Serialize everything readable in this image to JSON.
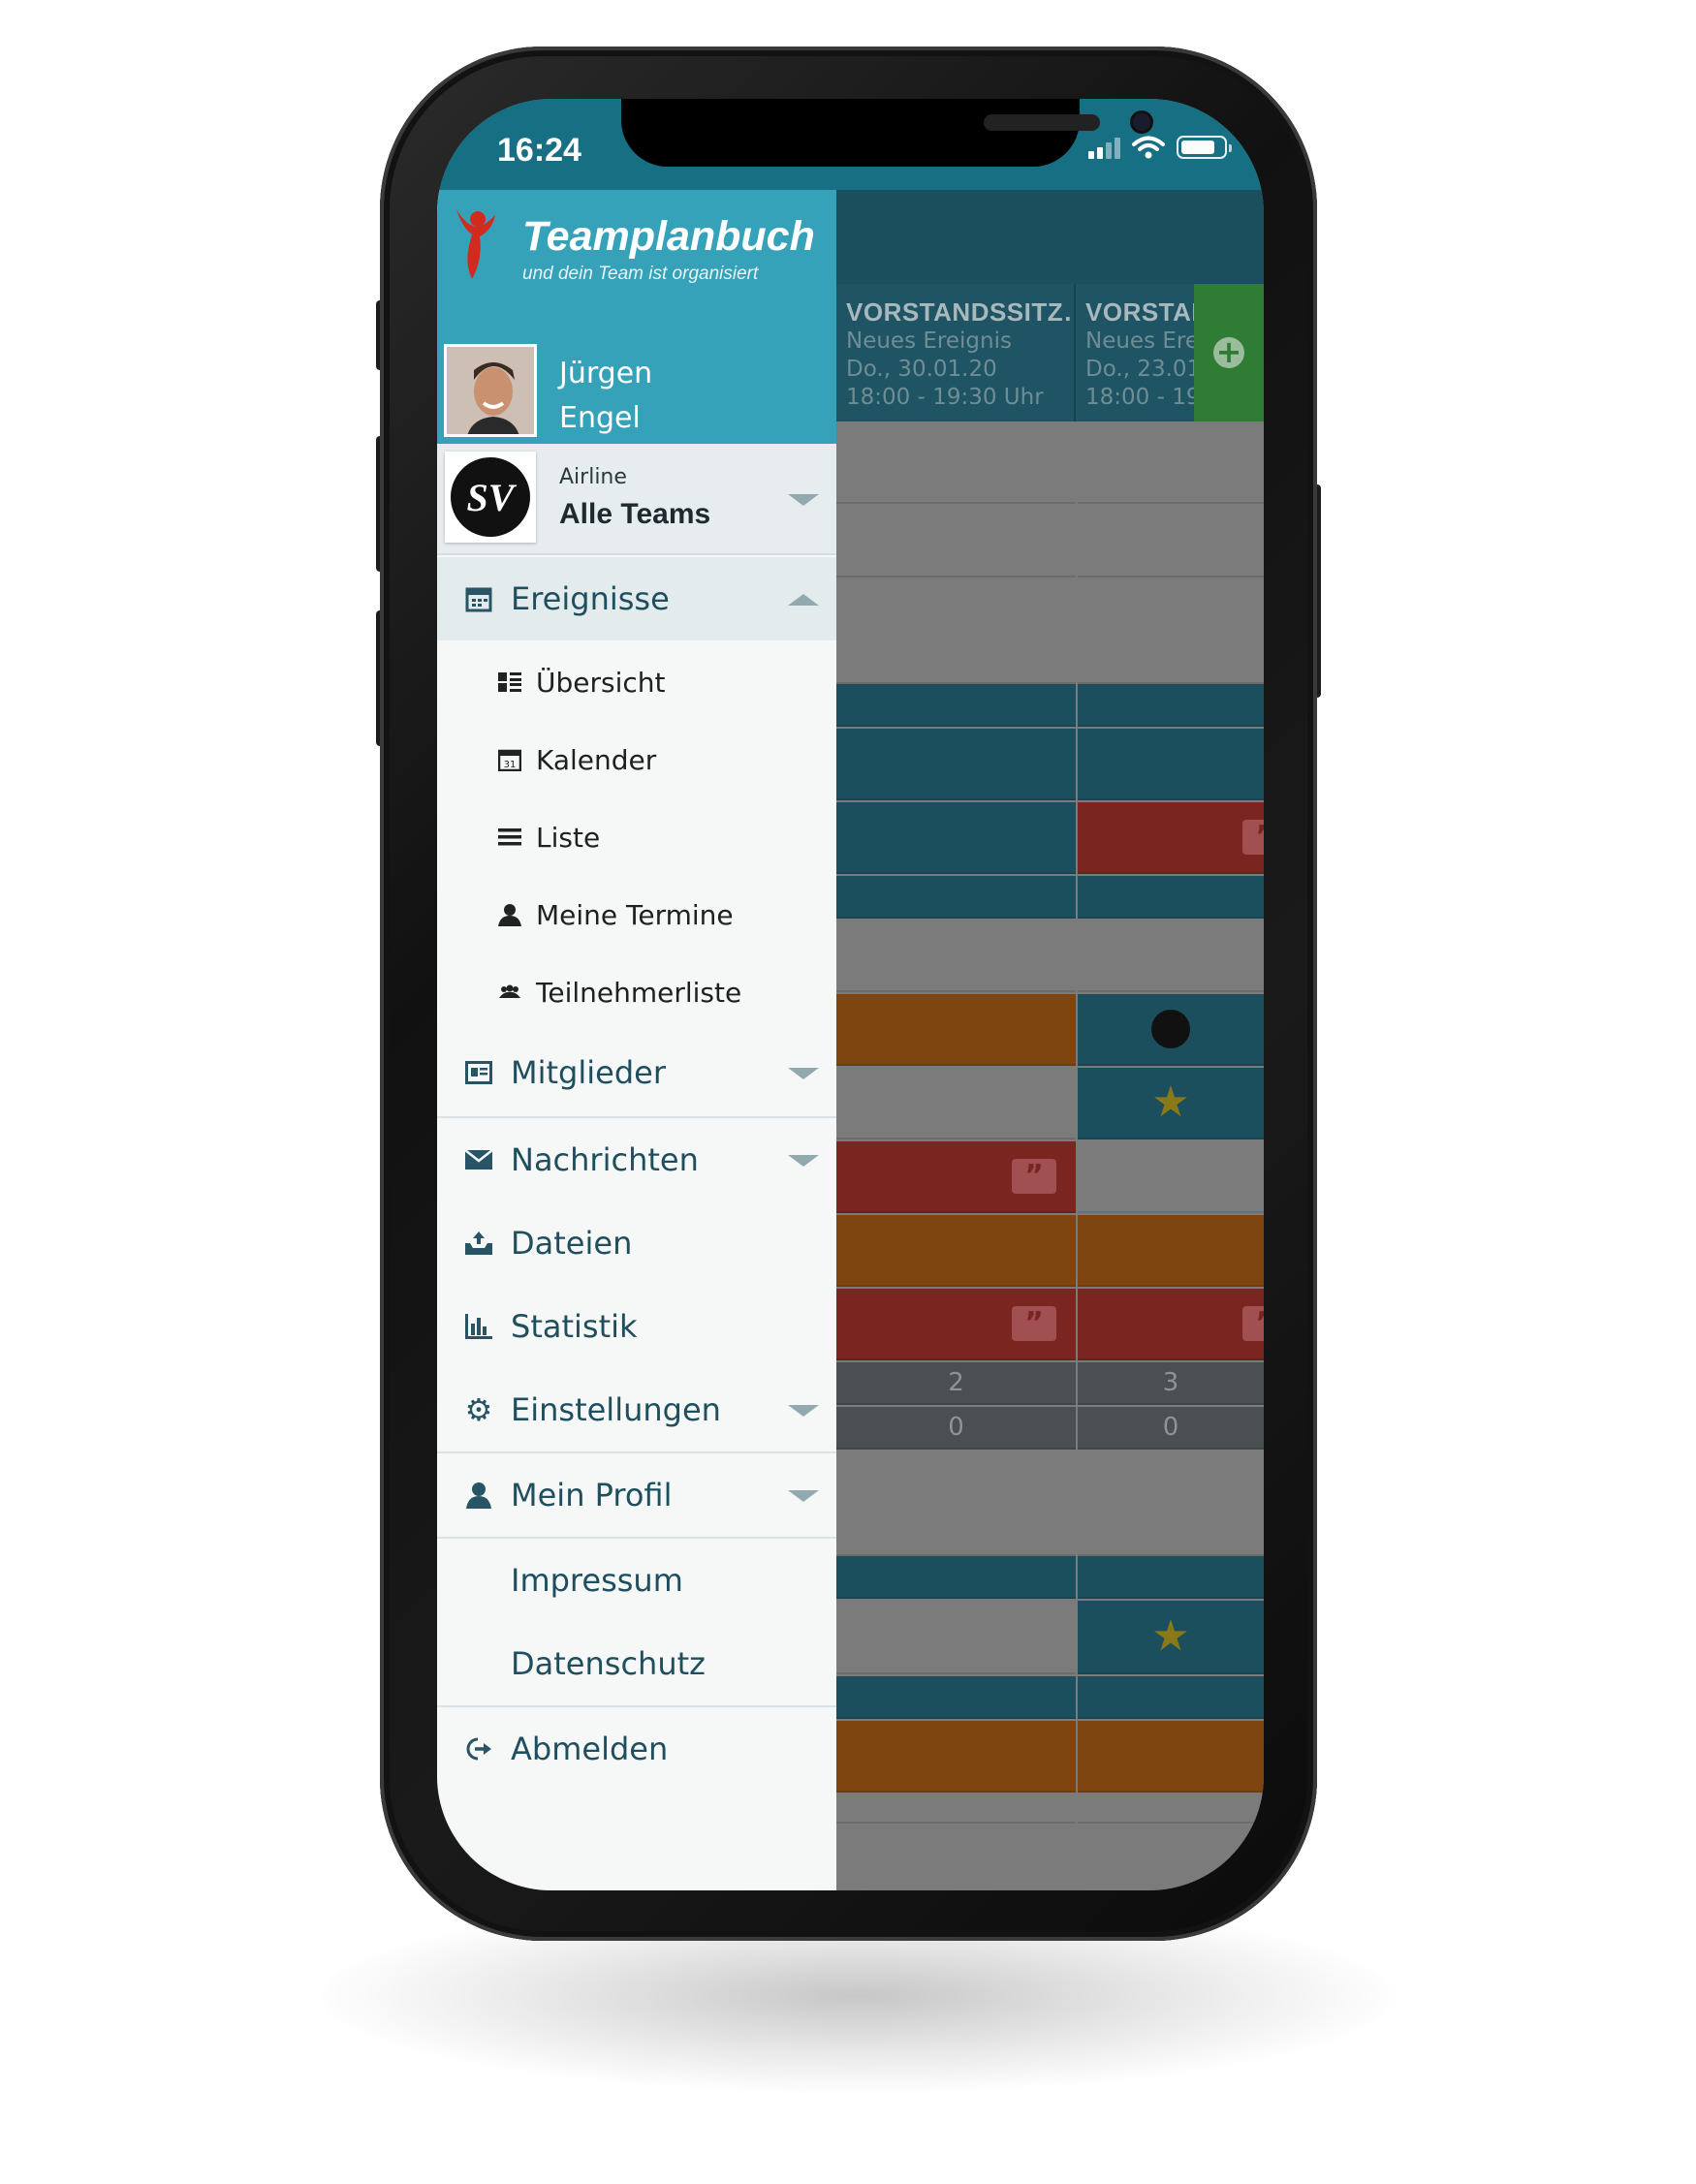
{
  "status_bar": {
    "time": "16:24"
  },
  "app": {
    "title": "Teamplanbuch",
    "subtitle": "und dein Team ist organisiert"
  },
  "user": {
    "first_name": "Jürgen",
    "last_name": "Engel"
  },
  "team": {
    "organization": "Airline",
    "name": "Alle Teams",
    "logo_text": "SV"
  },
  "menu": {
    "events": {
      "label": "Ereignisse",
      "icon": "calendar-icon",
      "expanded": true
    },
    "events_sub": [
      {
        "label": "Übersicht",
        "icon": "overview-icon"
      },
      {
        "label": "Kalender",
        "icon": "calendar-31-icon"
      },
      {
        "label": "Liste",
        "icon": "list-icon"
      },
      {
        "label": "Meine Termine",
        "icon": "user-icon"
      },
      {
        "label": "Teilnehmerliste",
        "icon": "group-icon"
      }
    ],
    "members": {
      "label": "Mitglieder",
      "icon": "id-card-icon"
    },
    "messages": {
      "label": "Nachrichten",
      "icon": "envelope-icon"
    },
    "files": {
      "label": "Dateien",
      "icon": "inbox-upload-icon"
    },
    "statistics": {
      "label": "Statistik",
      "icon": "bar-chart-icon"
    },
    "settings": {
      "label": "Einstellungen",
      "icon": "gear-icon"
    },
    "profile": {
      "label": "Mein Profil",
      "icon": "user-icon"
    },
    "imprint": {
      "label": "Impressum"
    },
    "privacy": {
      "label": "Datenschutz"
    },
    "logout": {
      "label": "Abmelden",
      "icon": "logout-icon"
    }
  },
  "calendar": {
    "columns": [
      {
        "title": "VORSTANDSSITZ…",
        "type": "Neues Ereignis",
        "date": "Do., 30.01.20",
        "time": "18:00 - 19:30 Uhr",
        "yes_count": "2",
        "no_count": "0"
      },
      {
        "title": "VORSTAND",
        "type": "Neues Ere",
        "date": "Do., 23.01",
        "time": "18:00 - 19",
        "yes_count": "3",
        "no_count": "0"
      }
    ]
  },
  "colors": {
    "brand": "#36a2ba",
    "status_bar": "#176f84",
    "teal_cell": "#1c4f5d",
    "red_cell": "#7a2520",
    "orange_cell": "#7f4510",
    "gray_cell": "#7b7b7b",
    "add_button": "#2f7c35"
  }
}
